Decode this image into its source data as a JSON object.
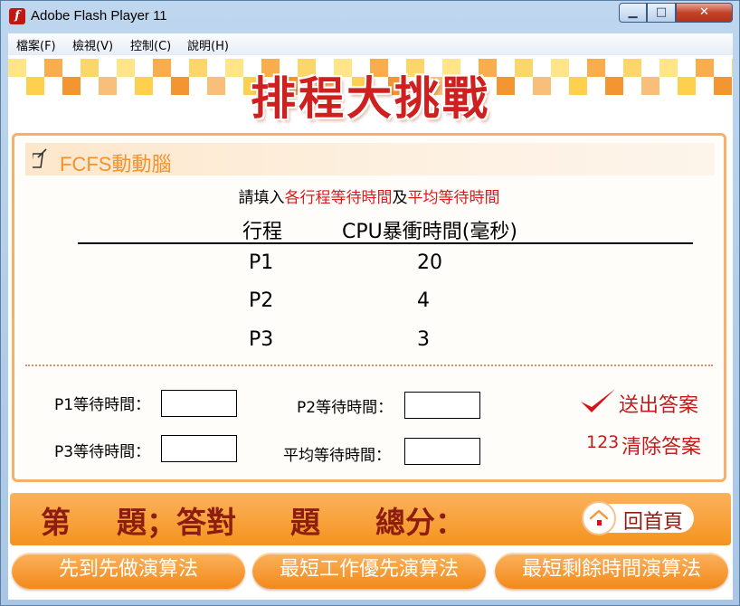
{
  "window": {
    "title": "Adobe Flash Player 11",
    "app_icon_glyph": "f",
    "close_glyph": "✕",
    "max_glyph": "□",
    "min_glyph": "▁"
  },
  "menu": [
    {
      "label": "檔案(F)"
    },
    {
      "label": "檢視(V)"
    },
    {
      "label": "控制(C)"
    },
    {
      "label": "說明(H)"
    }
  ],
  "banner": {
    "title": "排程大挑戰"
  },
  "panel": {
    "header": "FCFS動動腦",
    "instruction": {
      "prefix": "請填入",
      "part1": "各行程等待時間",
      "middle": "及",
      "part2": "平均等待時間"
    },
    "table": {
      "col_process": "行程",
      "col_burst": "CPU暴衝時間(毫秒)",
      "rows": [
        {
          "process": "P1",
          "burst": "20"
        },
        {
          "process": "P2",
          "burst": "4"
        },
        {
          "process": "P3",
          "burst": "3"
        }
      ]
    },
    "inputs": {
      "p1_label": "P1等待時間：",
      "p2_label": "P2等待時間：",
      "p3_label": "P3等待時間：",
      "avg_label": "平均等待時間："
    },
    "submit_label": "送出答案",
    "clear_number": "123",
    "clear_label": "清除答案"
  },
  "score": {
    "q_prefix": "第",
    "q_suffix": "題；答對",
    "correct_suffix": "題",
    "total_label": "總分："
  },
  "home_label": "回首頁",
  "algorithms": [
    {
      "label": "先到先做演算法"
    },
    {
      "label": "最短工作優先演算法"
    },
    {
      "label": "最短剩餘時間演算法"
    }
  ],
  "colors": {
    "accent": "#f5931e",
    "title_red": "#d01f1f",
    "dark_red": "#8c1d0f",
    "checker_orange": "#f28a1a",
    "checker_yellow": "#ffe27a"
  },
  "icons": {
    "checkmark": "check-icon",
    "home": "home-icon",
    "pencil": "notepad-icon"
  }
}
